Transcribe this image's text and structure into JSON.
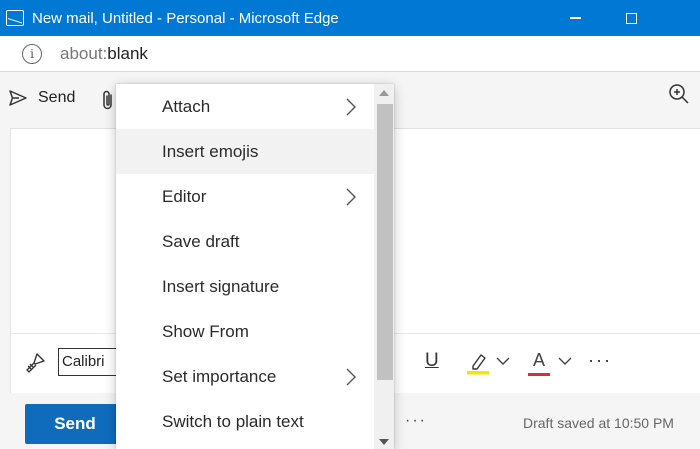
{
  "window": {
    "title": "New mail, Untitled - Personal - Microsoft Edge",
    "minimize_icon": "minimize-icon",
    "maximize_icon": "maximize-icon"
  },
  "address_bar": {
    "scheme": "about:",
    "path": "blank",
    "info_icon": "i"
  },
  "ribbon": {
    "send_label": "Send",
    "send_icon": "send-icon",
    "attach_icon": "paperclip-icon",
    "zoom_icon": "zoom-in-icon"
  },
  "format_bar": {
    "font_name": "Calibri",
    "underline_label": "U",
    "font_color_label": "A",
    "more_label": "···",
    "highlight_color": "#f2e600",
    "font_color": "#d13438"
  },
  "bottom_bar": {
    "send_label": "Send",
    "more_label": "···",
    "draft_status": "Draft saved at 10:50 PM",
    "send_color": "#0f6cbd"
  },
  "menu": {
    "items": [
      {
        "label": "Attach",
        "submenu": true
      },
      {
        "label": "Insert emojis",
        "submenu": false,
        "hover": true
      },
      {
        "label": "Editor",
        "submenu": true
      },
      {
        "label": "Save draft",
        "submenu": false
      },
      {
        "label": "Insert signature",
        "submenu": false
      },
      {
        "label": "Show From",
        "submenu": false
      },
      {
        "label": "Set importance",
        "submenu": true
      },
      {
        "label": "Switch to plain text",
        "submenu": false
      }
    ]
  },
  "colors": {
    "titlebar": "#0078d4",
    "menu_hover": "#f2f2f2"
  }
}
